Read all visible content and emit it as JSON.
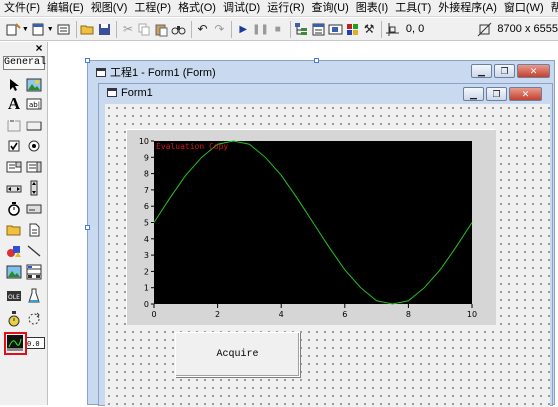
{
  "menu": [
    "文件(F)",
    "编辑(E)",
    "视图(V)",
    "工程(P)",
    "格式(O)",
    "调试(D)",
    "运行(R)",
    "查询(U)",
    "图表(I)",
    "工具(T)",
    "外接程序(A)",
    "窗口(W)",
    "帮助(H)"
  ],
  "toolbar": {
    "coords": "0, 0",
    "size": "8700 x 6555"
  },
  "toolbox": {
    "tab_label": "General",
    "close_label": "×"
  },
  "project_window": {
    "title": "工程1 - Form1 (Form)"
  },
  "form": {
    "title": "Form1",
    "acquire_label": "Acquire"
  },
  "chart_data": {
    "type": "line",
    "annotation": "Evaluation Copy",
    "x_ticks": [
      "0",
      "2",
      "4",
      "6",
      "8",
      "10"
    ],
    "y_ticks": [
      "0",
      "1",
      "2",
      "3",
      "4",
      "5",
      "6",
      "7",
      "8",
      "9",
      "10"
    ],
    "xlim": [
      0,
      10
    ],
    "ylim": [
      0,
      10
    ],
    "grid": false,
    "series": [
      {
        "color": "#22c522",
        "x": [
          0,
          0.5,
          1,
          1.5,
          2,
          2.5,
          3,
          3.5,
          4,
          4.5,
          5,
          5.5,
          6,
          6.5,
          7,
          7.5,
          8,
          8.5,
          9,
          9.5,
          10
        ],
        "y": [
          5,
          6.5,
          7.9,
          9.0,
          9.8,
          10.0,
          9.8,
          9.0,
          7.9,
          6.5,
          5,
          3.5,
          2.1,
          1.0,
          0.2,
          0,
          0.2,
          1.0,
          2.1,
          3.5,
          5
        ]
      }
    ],
    "colors": {
      "plot_bg": "#000000",
      "axis_text": "#ffffff",
      "annotation": "#d01818"
    }
  }
}
